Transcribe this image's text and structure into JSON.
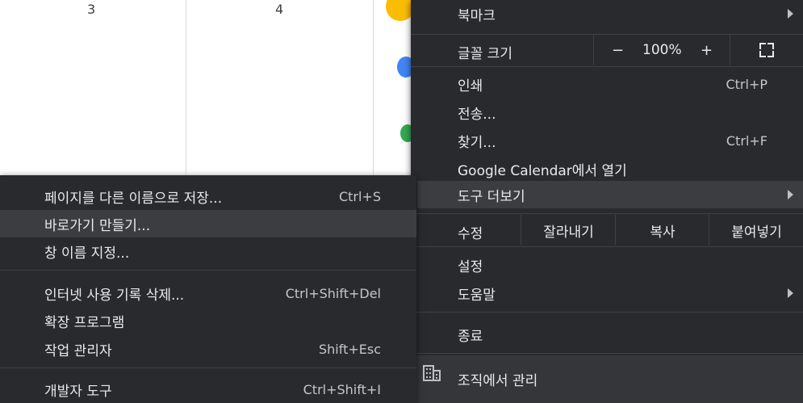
{
  "calendar": {
    "day_3": "3",
    "day_4": "4"
  },
  "main_menu": {
    "bookmarks": "북마크",
    "font_size": "글꼴 크기",
    "zoom_minus": "−",
    "zoom_value": "100%",
    "zoom_plus": "+",
    "print": "인쇄",
    "print_shortcut": "Ctrl+P",
    "cast": "전송...",
    "find": "찾기...",
    "find_shortcut": "Ctrl+F",
    "open_in_app": "Google Calendar에서 열기",
    "more_tools": "도구 더보기",
    "edit": "수정",
    "cut": "잘라내기",
    "copy": "복사",
    "paste": "붙여넣기",
    "settings": "설정",
    "help": "도움말",
    "exit": "종료",
    "managed": "조직에서 관리"
  },
  "sub_menu": {
    "save_page": "페이지를 다른 이름으로 저장...",
    "save_page_shortcut": "Ctrl+S",
    "create_shortcut": "바로가기 만들기...",
    "name_window": "창 이름 지정...",
    "clear_data": "인터넷 사용 기록 삭제...",
    "clear_data_shortcut": "Ctrl+Shift+Del",
    "extensions": "확장 프로그램",
    "task_manager": "작업 관리자",
    "task_manager_shortcut": "Shift+Esc",
    "dev_tools": "개발자 도구",
    "dev_tools_shortcut": "Ctrl+Shift+I"
  },
  "colors": {
    "menu_bg": "#292a2d",
    "highlight": "#3c3d40",
    "text": "#e8eaed"
  }
}
